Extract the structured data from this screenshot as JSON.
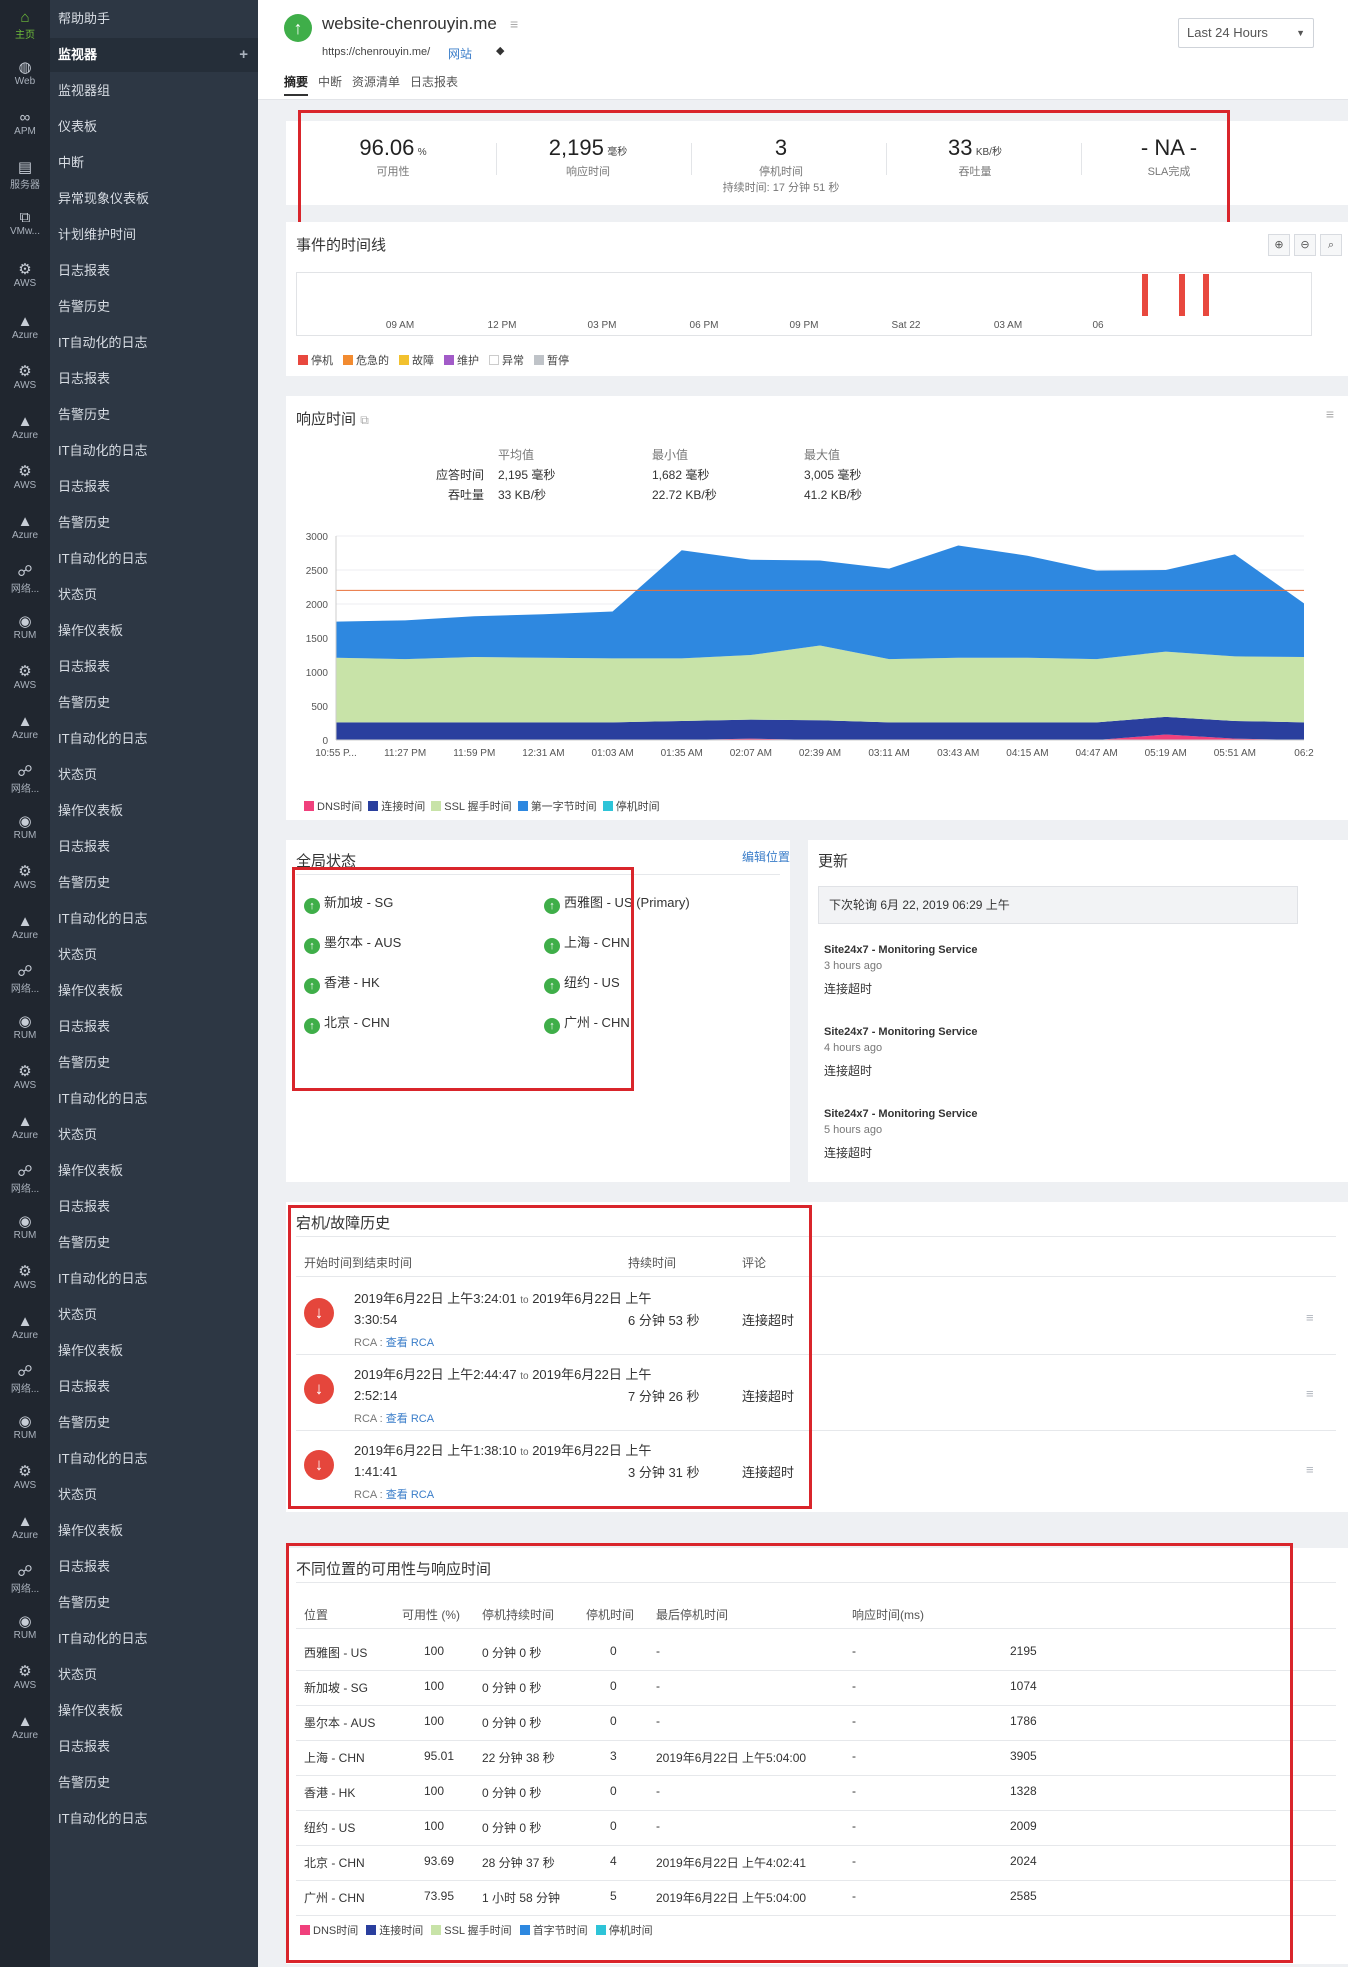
{
  "sidebar_strip": [
    {
      "label": "主页",
      "icon": "home-icon"
    },
    {
      "label": "Web",
      "icon": "globe-icon"
    },
    {
      "label": "APM",
      "icon": "binoculars-icon"
    },
    {
      "label": "服务器",
      "icon": "server-icon"
    },
    {
      "label": "VMw...",
      "icon": "vm-icon"
    },
    {
      "label": "AWS",
      "icon": "aws-icon"
    },
    {
      "label": "Azure",
      "icon": "azure-icon"
    },
    {
      "label": "AWS",
      "icon": "aws-icon"
    },
    {
      "label": "Azure",
      "icon": "azure-icon"
    },
    {
      "label": "AWS",
      "icon": "aws-icon"
    },
    {
      "label": "Azure",
      "icon": "azure-icon"
    },
    {
      "label": "网络...",
      "icon": "network-icon"
    },
    {
      "label": "RUM",
      "icon": "rum-icon"
    },
    {
      "label": "AWS",
      "icon": "aws-icon"
    },
    {
      "label": "Azure",
      "icon": "azure-icon"
    },
    {
      "label": "网络...",
      "icon": "network-icon"
    },
    {
      "label": "RUM",
      "icon": "rum-icon"
    },
    {
      "label": "AWS",
      "icon": "aws-icon"
    },
    {
      "label": "Azure",
      "icon": "azure-icon"
    },
    {
      "label": "网络...",
      "icon": "network-icon"
    },
    {
      "label": "RUM",
      "icon": "rum-icon"
    },
    {
      "label": "AWS",
      "icon": "aws-icon"
    },
    {
      "label": "Azure",
      "icon": "azure-icon"
    },
    {
      "label": "网络...",
      "icon": "network-icon"
    },
    {
      "label": "RUM",
      "icon": "rum-icon"
    },
    {
      "label": "AWS",
      "icon": "aws-icon"
    },
    {
      "label": "Azure",
      "icon": "azure-icon"
    },
    {
      "label": "网络...",
      "icon": "network-icon"
    },
    {
      "label": "RUM",
      "icon": "rum-icon"
    },
    {
      "label": "AWS",
      "icon": "aws-icon"
    },
    {
      "label": "Azure",
      "icon": "azure-icon"
    },
    {
      "label": "网络...",
      "icon": "network-icon"
    },
    {
      "label": "RUM",
      "icon": "rum-icon"
    },
    {
      "label": "AWS",
      "icon": "aws-icon"
    },
    {
      "label": "Azure",
      "icon": "azure-icon"
    }
  ],
  "menu": [
    {
      "label": "帮助助手"
    },
    {
      "label": "监视器",
      "active": true,
      "plus": "+"
    },
    {
      "label": "监视器组"
    },
    {
      "label": "仪表板"
    },
    {
      "label": "中断"
    },
    {
      "label": "异常现象仪表板"
    },
    {
      "label": "计划维护时间"
    },
    {
      "label": "日志报表"
    },
    {
      "label": "告警历史"
    },
    {
      "label": "IT自动化的日志"
    },
    {
      "label": "日志报表"
    },
    {
      "label": "告警历史"
    },
    {
      "label": "IT自动化的日志"
    },
    {
      "label": "日志报表"
    },
    {
      "label": "告警历史"
    },
    {
      "label": "IT自动化的日志"
    },
    {
      "label": "状态页"
    },
    {
      "label": "操作仪表板"
    },
    {
      "label": "日志报表"
    },
    {
      "label": "告警历史"
    },
    {
      "label": "IT自动化的日志"
    },
    {
      "label": "状态页"
    },
    {
      "label": "操作仪表板"
    },
    {
      "label": "日志报表"
    },
    {
      "label": "告警历史"
    },
    {
      "label": "IT自动化的日志"
    },
    {
      "label": "状态页"
    },
    {
      "label": "操作仪表板"
    },
    {
      "label": "日志报表"
    },
    {
      "label": "告警历史"
    },
    {
      "label": "IT自动化的日志"
    },
    {
      "label": "状态页"
    },
    {
      "label": "操作仪表板"
    },
    {
      "label": "日志报表"
    },
    {
      "label": "告警历史"
    },
    {
      "label": "IT自动化的日志"
    },
    {
      "label": "状态页"
    },
    {
      "label": "操作仪表板"
    },
    {
      "label": "日志报表"
    },
    {
      "label": "告警历史"
    },
    {
      "label": "IT自动化的日志"
    },
    {
      "label": "状态页"
    },
    {
      "label": "操作仪表板"
    },
    {
      "label": "日志报表"
    },
    {
      "label": "告警历史"
    },
    {
      "label": "IT自动化的日志"
    },
    {
      "label": "状态页"
    },
    {
      "label": "操作仪表板"
    },
    {
      "label": "日志报表"
    },
    {
      "label": "告警历史"
    },
    {
      "label": "IT自动化的日志"
    }
  ],
  "header": {
    "monitor_name": "website-chenrouyin.me",
    "url": "https://chenrouyin.me/",
    "type": "网站",
    "time_range": "Last 24 Hours",
    "tabs": [
      "摘要",
      "中断",
      "资源清单",
      "日志报表"
    ]
  },
  "summary": {
    "availability": {
      "value": "96.06",
      "unit": "%",
      "label": "可用性"
    },
    "response": {
      "value": "2,195",
      "unit": "毫秒",
      "label": "响应时间"
    },
    "downtime": {
      "value": "3",
      "label": "停机时间",
      "sub": "持续时间: 17 分钟 51 秒"
    },
    "throughput": {
      "value": "33",
      "unit": "KB/秒",
      "label": "吞吐量"
    },
    "sla": {
      "value": "- NA -",
      "label": "SLA完成"
    }
  },
  "timeline": {
    "title": "事件的时间线",
    "ticks": [
      "09 AM",
      "12 PM",
      "03 PM",
      "06 PM",
      "09 PM",
      "Sat 22",
      "03 AM",
      "06"
    ],
    "legend": [
      {
        "label": "停机",
        "color": "#e8483e"
      },
      {
        "label": "危急的",
        "color": "#f28b30"
      },
      {
        "label": "故障",
        "color": "#f2c12e"
      },
      {
        "label": "维护",
        "color": "#a25bc8"
      },
      {
        "label": "异常",
        "color": "#ffffff"
      },
      {
        "label": "暂停",
        "color": "#bfc3c8"
      }
    ]
  },
  "response_time": {
    "title": "响应时间",
    "stats_headers": [
      "平均值",
      "最小值",
      "最大值"
    ],
    "stats_rows": [
      {
        "label": "应答时间",
        "avg": "2,195 毫秒",
        "min": "1,682 毫秒",
        "max": "3,005 毫秒"
      },
      {
        "label": "吞吐量",
        "avg": "33 KB/秒",
        "min": "22.72 KB/秒",
        "max": "41.2 KB/秒"
      }
    ]
  },
  "chart_data": {
    "type": "area",
    "stacked": true,
    "x": [
      "10:55 P...",
      "11:27 PM",
      "11:59 PM",
      "12:31 AM",
      "01:03 AM",
      "01:35 AM",
      "02:07 AM",
      "02:39 AM",
      "03:11 AM",
      "03:43 AM",
      "04:15 AM",
      "04:47 AM",
      "05:19 AM",
      "05:51 AM",
      "06:2"
    ],
    "ylim": [
      0,
      3000
    ],
    "yticks": [
      0,
      500,
      1000,
      1500,
      2000,
      2500,
      3000
    ],
    "threshold": 2200,
    "series": [
      {
        "name": "DNS时间",
        "color": "#f0407c",
        "values": [
          0,
          0,
          0,
          0,
          0,
          0,
          20,
          0,
          0,
          0,
          0,
          0,
          80,
          20,
          0
        ]
      },
      {
        "name": "连接时间",
        "color": "#2a3f9e",
        "values": [
          260,
          260,
          260,
          260,
          260,
          280,
          280,
          290,
          260,
          260,
          260,
          260,
          260,
          260,
          260
        ]
      },
      {
        "name": "SSL 握手时间",
        "color": "#c8e3a8",
        "values": [
          950,
          930,
          960,
          950,
          940,
          920,
          950,
          1100,
          930,
          950,
          950,
          930,
          960,
          950,
          960
        ]
      },
      {
        "name": "第一字节时间",
        "color": "#2e88e0",
        "values": [
          530,
          570,
          600,
          640,
          690,
          1590,
          1400,
          1250,
          1330,
          1650,
          1500,
          1300,
          1200,
          1500,
          790
        ]
      },
      {
        "name": "停机时间",
        "color": "#2ec4d8",
        "values": [
          0,
          0,
          0,
          0,
          0,
          0,
          0,
          0,
          0,
          0,
          0,
          0,
          0,
          0,
          0
        ]
      }
    ]
  },
  "chart_legend": [
    "DNS时间",
    "连接时间",
    "SSL 握手时间",
    "第一字节时间",
    "停机时间"
  ],
  "global_status": {
    "title": "全局状态",
    "edit": "编辑位置",
    "locations": [
      "新加坡 - SG",
      "西雅图 - US (Primary)",
      "墨尔本 - AUS",
      "上海 - CHN",
      "香港 - HK",
      "纽约 - US",
      "北京 - CHN",
      "广州 - CHN"
    ]
  },
  "updates": {
    "title": "更新",
    "next_poll": "下次轮询 6月 22, 2019 06:29 上午",
    "items": [
      {
        "source": "Site24x7 - Monitoring Service",
        "when": "3 hours ago",
        "msg": "连接超时"
      },
      {
        "source": "Site24x7 - Monitoring Service",
        "when": "4 hours ago",
        "msg": "连接超时"
      },
      {
        "source": "Site24x7 - Monitoring Service",
        "when": "5 hours ago",
        "msg": "连接超时"
      }
    ]
  },
  "outages": {
    "title": "宕机/故障历史",
    "headers": [
      "开始时间到结束时间",
      "持续时间",
      "评论"
    ],
    "rows": [
      {
        "start": "2019年6月22日 上午3:24:01",
        "to": "to",
        "end_a": "2019年6月22日 上午",
        "end_b": "3:30:54",
        "rca_label": "RCA : ",
        "rca_link": "查看 RCA",
        "duration": "6 分钟 53 秒",
        "comment": "连接超时"
      },
      {
        "start": "2019年6月22日 上午2:44:47",
        "to": "to",
        "end_a": "2019年6月22日 上午",
        "end_b": "2:52:14",
        "rca_label": "RCA : ",
        "rca_link": "查看 RCA",
        "duration": "7 分钟 26 秒",
        "comment": "连接超时"
      },
      {
        "start": "2019年6月22日 上午1:38:10",
        "to": "to",
        "end_a": "2019年6月22日 上午",
        "end_b": "1:41:41",
        "rca_label": "RCA : ",
        "rca_link": "查看 RCA",
        "duration": "3 分钟 31 秒",
        "comment": "连接超时"
      }
    ]
  },
  "locations_table": {
    "title": "不同位置的可用性与响应时间",
    "headers": [
      "位置",
      "可用性 (%)",
      "停机持续时间",
      "停机时间",
      "最后停机时间",
      "响应时间(ms)"
    ],
    "rows": [
      {
        "loc": "西雅图 - US",
        "avail": "100",
        "dur": "0 分钟 0 秒",
        "count": "0",
        "last": "-",
        "dash": "-",
        "resp": "2195"
      },
      {
        "loc": "新加坡 - SG",
        "avail": "100",
        "dur": "0 分钟 0 秒",
        "count": "0",
        "last": "-",
        "dash": "-",
        "resp": "1074"
      },
      {
        "loc": "墨尔本 - AUS",
        "avail": "100",
        "dur": "0 分钟 0 秒",
        "count": "0",
        "last": "-",
        "dash": "-",
        "resp": "1786"
      },
      {
        "loc": "上海 - CHN",
        "avail": "95.01",
        "dur": "22 分钟 38 秒",
        "count": "3",
        "last": "2019年6月22日 上午5:04:00",
        "dash": "-",
        "resp": "3905"
      },
      {
        "loc": "香港 - HK",
        "avail": "100",
        "dur": "0 分钟 0 秒",
        "count": "0",
        "last": "-",
        "dash": "-",
        "resp": "1328"
      },
      {
        "loc": "纽约 - US",
        "avail": "100",
        "dur": "0 分钟 0 秒",
        "count": "0",
        "last": "-",
        "dash": "-",
        "resp": "2009"
      },
      {
        "loc": "北京 - CHN",
        "avail": "93.69",
        "dur": "28 分钟 37 秒",
        "count": "4",
        "last": "2019年6月22日 上午4:02:41",
        "dash": "-",
        "resp": "2024"
      },
      {
        "loc": "广州 - CHN",
        "avail": "73.95",
        "dur": "1 小时 58 分钟",
        "count": "5",
        "last": "2019年6月22日 上午5:04:00",
        "dash": "-",
        "resp": "2585"
      }
    ],
    "legend": [
      "DNS时间",
      "连接时间",
      "SSL 握手时间",
      "首字节时间",
      "停机时间"
    ]
  },
  "colors": {
    "up": "#3fae49",
    "down": "#e5463c",
    "highlight": "#d9252b",
    "link": "#3a7dc9"
  }
}
